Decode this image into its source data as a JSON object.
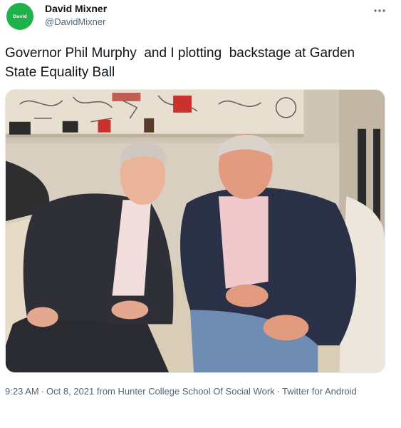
{
  "author": {
    "avatar_text": "David",
    "name": "David Mixner",
    "handle": "@DavidMixner"
  },
  "tweet": {
    "text": "Governor Phil Murphy  and I plotting  backstage at Garden State Equality Ball"
  },
  "meta": {
    "time": "9:23 AM",
    "date": "Oct 8, 2021",
    "from": "from",
    "location": "Hunter College School Of Social Work",
    "separator": "·",
    "source": "Twitter for Android"
  },
  "icons": {
    "more": "more-icon"
  },
  "colors": {
    "text_primary": "#0f1419",
    "text_secondary": "#536471",
    "avatar_bg": "#1fb14a",
    "border": "#e6e9ec"
  }
}
